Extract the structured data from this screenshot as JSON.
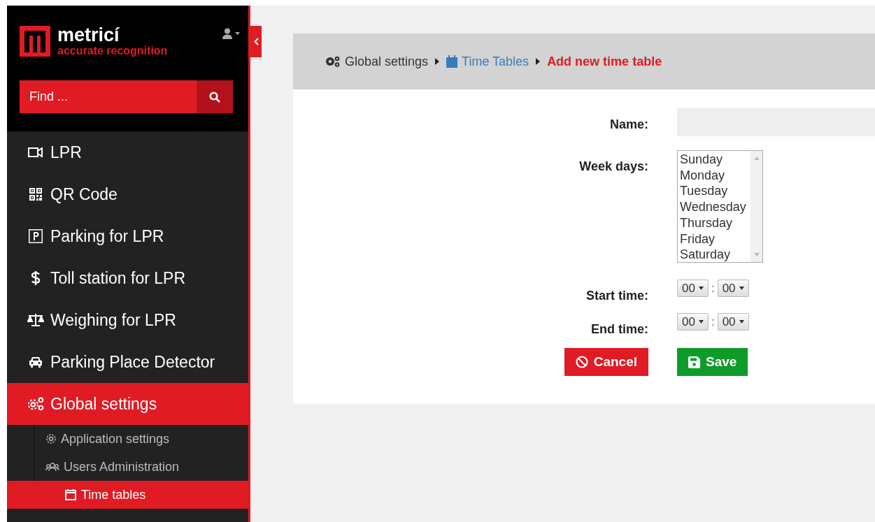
{
  "logo": {
    "name": "metricí",
    "tagline": "accurate recognition"
  },
  "search": {
    "placeholder": "Find ..."
  },
  "menu": [
    {
      "label": "LPR",
      "selected": false
    },
    {
      "label": "QR Code",
      "selected": false
    },
    {
      "label": "Parking for LPR",
      "selected": false
    },
    {
      "label": "Toll station for LPR",
      "selected": false
    },
    {
      "label": "Weighing for LPR",
      "selected": false
    },
    {
      "label": "Parking Place Detector",
      "selected": false
    },
    {
      "label": "Global settings",
      "selected": true,
      "children": [
        {
          "label": "Application settings",
          "selected": false
        },
        {
          "label": "Users Administration",
          "selected": false
        },
        {
          "label": "Time tables",
          "selected": true
        }
      ]
    }
  ],
  "breadcrumb": [
    {
      "label": "Global settings",
      "kind": "plain"
    },
    {
      "label": "Time Tables",
      "kind": "link"
    },
    {
      "label": "Add new time table",
      "kind": "current"
    }
  ],
  "form": {
    "name_label": "Name:",
    "weekdays_label": "Week days:",
    "weekdays": [
      {
        "label": "Sunday",
        "selected": false
      },
      {
        "label": "Monday",
        "selected": false
      },
      {
        "label": "Tuesday",
        "selected": false
      },
      {
        "label": "Wednesday",
        "selected": false
      },
      {
        "label": "Thursday",
        "selected": false
      },
      {
        "label": "Friday",
        "selected": false
      },
      {
        "label": "Saturday",
        "selected": false
      }
    ],
    "start_label": "Start time:",
    "start_time": {
      "hour": "00",
      "separator": ":",
      "minute": "00"
    },
    "end_label": "End time:",
    "end_time": {
      "hour": "00",
      "separator": ":",
      "minute": "00"
    },
    "cancel": "Cancel",
    "save": "Save"
  }
}
